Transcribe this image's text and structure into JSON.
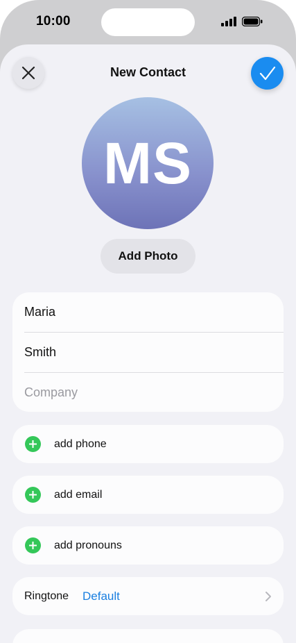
{
  "status_bar": {
    "time": "10:00",
    "icons": [
      "cellular-signal-icon",
      "battery-icon"
    ]
  },
  "nav": {
    "title": "New Contact",
    "close_icon": "close-icon",
    "done_icon": "checkmark-icon"
  },
  "avatar": {
    "initials": "MS",
    "add_photo_label": "Add Photo"
  },
  "name_fields": {
    "first_name": "Maria",
    "last_name": "Smith",
    "company_placeholder": "Company"
  },
  "add_rows": [
    {
      "label": "add phone"
    },
    {
      "label": "add email"
    },
    {
      "label": "add pronouns"
    }
  ],
  "ringtone": {
    "label": "Ringtone",
    "value": "Default"
  },
  "colors": {
    "accent_blue": "#1a8cf0",
    "add_green": "#34c759",
    "sheet_background": "#f1f1f6"
  }
}
